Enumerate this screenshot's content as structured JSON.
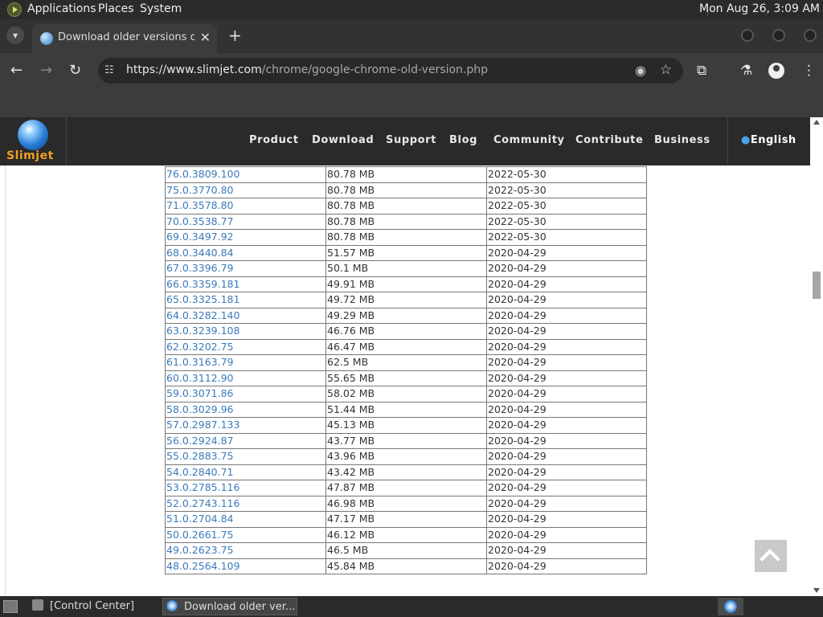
{
  "panel": {
    "menus": [
      "Applications",
      "Places",
      "System"
    ],
    "clock": "Mon Aug 26,  3:09 AM"
  },
  "browser": {
    "tab_title": "Download older versions of G",
    "tab_close": "✕",
    "new_tab": "+",
    "url_host": "https://www.slimjet.com",
    "url_path": "/chrome/google-chrome-old-version.php"
  },
  "site": {
    "logo_text": "Slimjet",
    "nav": [
      "Product",
      "Download",
      "Support",
      "Blog",
      "Community",
      "Contribute",
      "Business"
    ],
    "language": "English"
  },
  "versions": [
    {
      "version": "76.0.3809.100",
      "size": "80.78 MB",
      "date": "2022-05-30"
    },
    {
      "version": "75.0.3770.80",
      "size": "80.78 MB",
      "date": "2022-05-30"
    },
    {
      "version": "71.0.3578.80",
      "size": "80.78 MB",
      "date": "2022-05-30"
    },
    {
      "version": "70.0.3538.77",
      "size": "80.78 MB",
      "date": "2022-05-30"
    },
    {
      "version": "69.0.3497.92",
      "size": "80.78 MB",
      "date": "2022-05-30"
    },
    {
      "version": "68.0.3440.84",
      "size": "51.57 MB",
      "date": "2020-04-29"
    },
    {
      "version": "67.0.3396.79",
      "size": "50.1 MB",
      "date": "2020-04-29"
    },
    {
      "version": "66.0.3359.181",
      "size": "49.91 MB",
      "date": "2020-04-29"
    },
    {
      "version": "65.0.3325.181",
      "size": "49.72 MB",
      "date": "2020-04-29"
    },
    {
      "version": "64.0.3282.140",
      "size": "49.29 MB",
      "date": "2020-04-29"
    },
    {
      "version": "63.0.3239.108",
      "size": "46.76 MB",
      "date": "2020-04-29"
    },
    {
      "version": "62.0.3202.75",
      "size": "46.47 MB",
      "date": "2020-04-29"
    },
    {
      "version": "61.0.3163.79",
      "size": "62.5 MB",
      "date": "2020-04-29"
    },
    {
      "version": "60.0.3112.90",
      "size": "55.65 MB",
      "date": "2020-04-29"
    },
    {
      "version": "59.0.3071.86",
      "size": "58.02 MB",
      "date": "2020-04-29"
    },
    {
      "version": "58.0.3029.96",
      "size": "51.44 MB",
      "date": "2020-04-29"
    },
    {
      "version": "57.0.2987.133",
      "size": "45.13 MB",
      "date": "2020-04-29"
    },
    {
      "version": "56.0.2924.87",
      "size": "43.77 MB",
      "date": "2020-04-29"
    },
    {
      "version": "55.0.2883.75",
      "size": "43.96 MB",
      "date": "2020-04-29"
    },
    {
      "version": "54.0.2840.71",
      "size": "43.42 MB",
      "date": "2020-04-29"
    },
    {
      "version": "53.0.2785.116",
      "size": "47.87 MB",
      "date": "2020-04-29"
    },
    {
      "version": "52.0.2743.116",
      "size": "46.98 MB",
      "date": "2020-04-29"
    },
    {
      "version": "51.0.2704.84",
      "size": "47.17 MB",
      "date": "2020-04-29"
    },
    {
      "version": "50.0.2661.75",
      "size": "46.12 MB",
      "date": "2020-04-29"
    },
    {
      "version": "49.0.2623.75",
      "size": "46.5 MB",
      "date": "2020-04-29"
    },
    {
      "version": "48.0.2564.109",
      "size": "45.84 MB",
      "date": "2020-04-29"
    }
  ],
  "taskbar": {
    "tasks": [
      "[Control Center]",
      "Download older ver..."
    ]
  },
  "colors": {
    "link": "#3a7ab8",
    "site_header": "#2a2a2a",
    "logo": "#f0a020"
  }
}
